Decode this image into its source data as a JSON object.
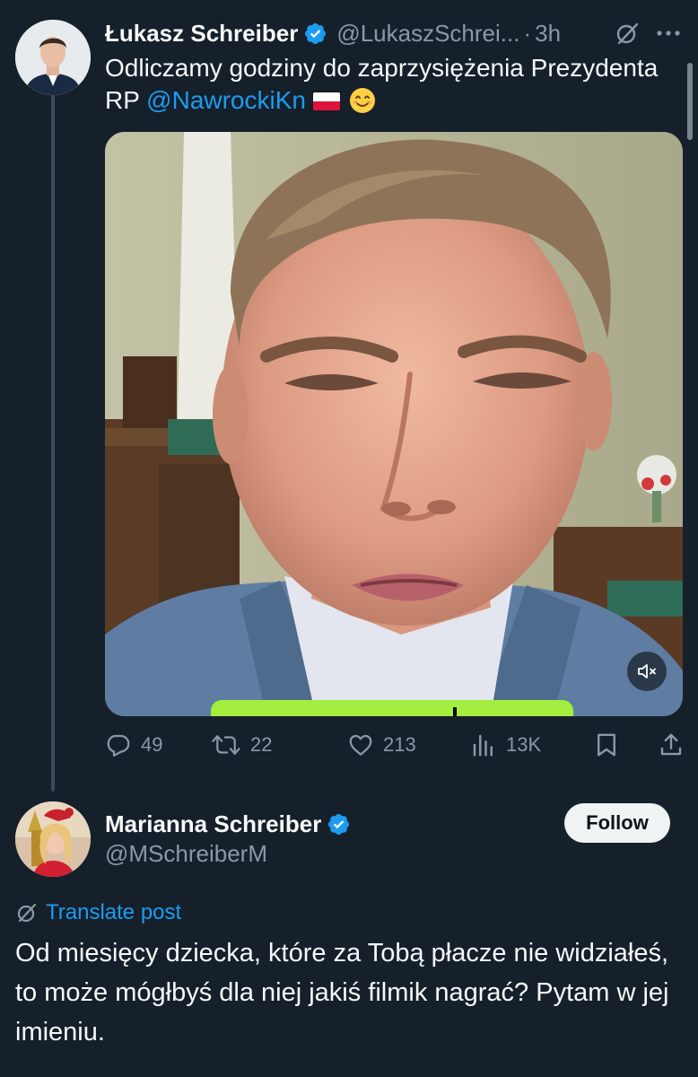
{
  "tweet1": {
    "author_name": "Łukasz Schreiber",
    "handle": "@LukaszSchrei...",
    "separator": "·",
    "time": "3h",
    "text_before_mention": "Odliczamy godziny do zaprzysiężenia Prezydenta RP ",
    "mention": "@NawrockiKn",
    "stats": {
      "replies": "49",
      "reposts": "22",
      "likes": "213",
      "views": "13K"
    }
  },
  "tweet2": {
    "author_name": "Marianna Schreiber",
    "handle": "@MSchreiberM",
    "follow_label": "Follow",
    "translate_label": "Translate post",
    "text": "Od miesięcy dziecka, które za Tobą płacze nie widziałeś, to może mógłbyś dla niej jakiś filmik nagrać? Pytam w jej imieniu."
  },
  "colors": {
    "background": "#15202b",
    "accent": "#1d9bf0",
    "muted": "#8b98a5",
    "text": "#f7f9f9"
  },
  "icons": {
    "verified": "verified-badge-icon",
    "grok": "grok-icon",
    "more": "more-icon",
    "reply": "reply-icon",
    "repost": "repost-icon",
    "like": "like-icon",
    "views": "views-icon",
    "bookmark": "bookmark-icon",
    "share": "share-icon",
    "mute": "mute-icon",
    "translate": "translate-icon"
  }
}
